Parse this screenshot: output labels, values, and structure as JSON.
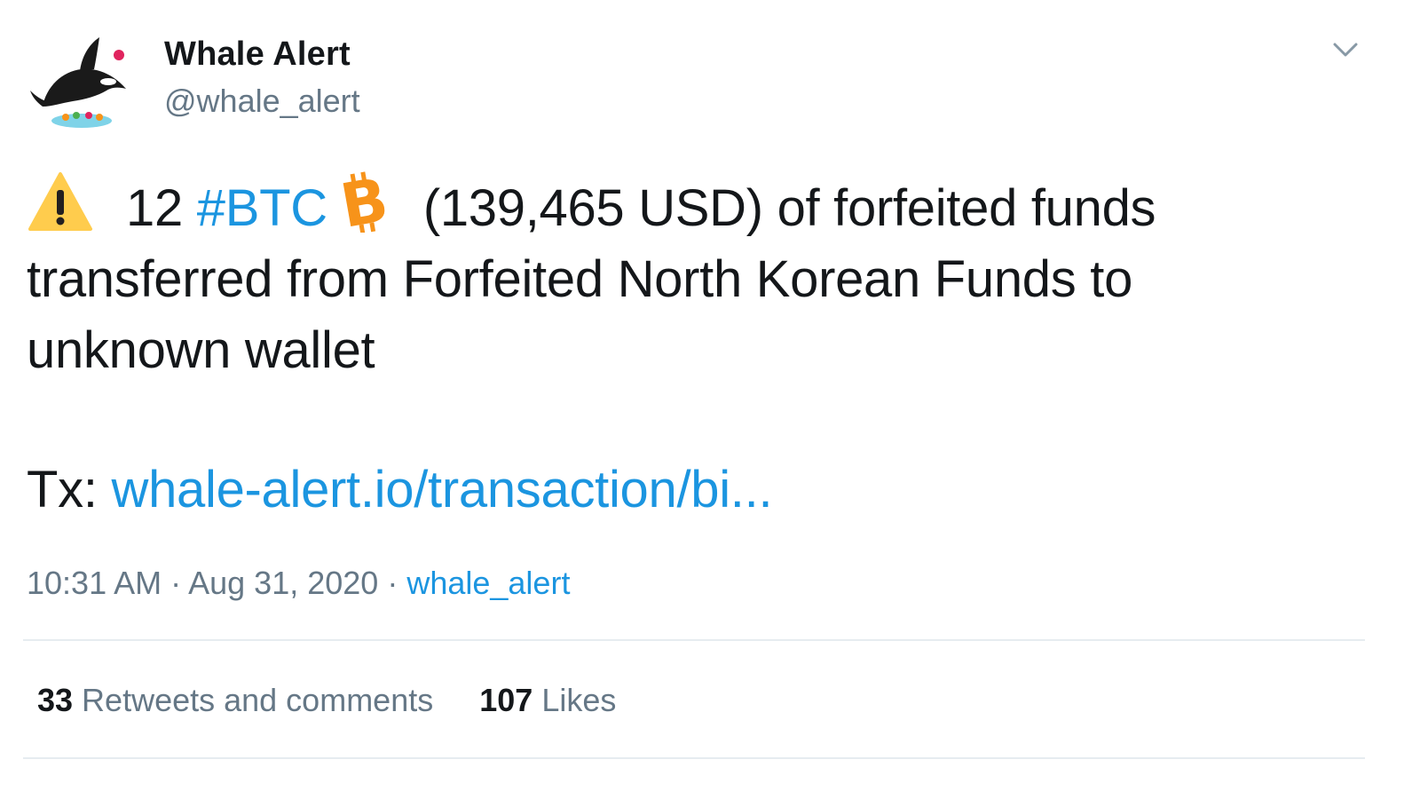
{
  "user": {
    "name": "Whale Alert",
    "handle": "@whale_alert",
    "avatar_icon": "orca-whale-avatar"
  },
  "tweet": {
    "warning_icon": "warning-sign-icon",
    "amount": "12",
    "hashtag": "#BTC",
    "currency_icon": "bitcoin-icon",
    "text_rest": "(139,465 USD) of forfeited funds transferred from Forfeited North Korean Funds to unknown wallet",
    "tx_label": "Tx:",
    "tx_link": "whale-alert.io/transaction/bi..."
  },
  "meta": {
    "time": "10:31 AM",
    "sep1": " · ",
    "date": "Aug 31, 2020",
    "sep2": " · ",
    "source": "whale_alert"
  },
  "stats": {
    "retweets_count": "33",
    "retweets_label": "Retweets and comments",
    "likes_count": "107",
    "likes_label": "Likes"
  },
  "colors": {
    "link": "#1b95e0",
    "secondary_text": "#657786",
    "primary_text": "#14171a",
    "divider": "#e6ecf0",
    "bitcoin": "#f7931a",
    "warning": "#ffcc4d"
  }
}
